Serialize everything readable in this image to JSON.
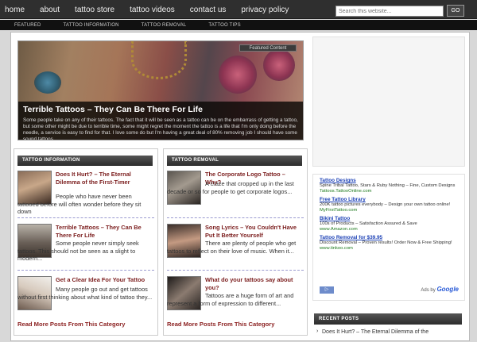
{
  "nav": {
    "items": [
      "home",
      "about",
      "tattoo store",
      "tattoo videos",
      "contact us",
      "privacy policy"
    ],
    "search_placeholder": "Search this website...",
    "go_label": "GO"
  },
  "subnav": {
    "items": [
      "FEATURED",
      "TATTOO INFORMATION",
      "TATTOO REMOVAL",
      "TATTOO TIPS"
    ]
  },
  "featured": {
    "badge": "Featured Content",
    "title": "Terrible Tattoos – They Can Be There For Life",
    "text": "Some people take on any of their tattoos. The fact that it will be seen as a tattoo can be on the embarrass of getting a tattoo, but some other might be due to terrible time, some might regret the moment the tattoo is a life that I'm only doing before the needle, a service is easy to find for that. I love some do but I'm having a great deal of 80% removing job I should have some sound tattoos."
  },
  "tattoo_info": {
    "header": "TATTOO INFORMATION",
    "posts": [
      {
        "title": "Does It Hurt? – The Eternal Dilemma of the First-Timer",
        "excerpt": "People who have never been tattooed before will often wonder before they sit down"
      },
      {
        "title": "Terrible Tattoos – They Can Be There For Life",
        "excerpt": "Some people never simply seek tattoos. This should not be seen as a slight to modern..."
      },
      {
        "title": "Get a Clear Idea For Your Tattoo",
        "excerpt": "Many people go out and get tattoos without first thinking about what kind of tattoo they..."
      }
    ],
    "read_more": "Read More Posts From This Category"
  },
  "tattoo_removal": {
    "header": "TATTOO REMOVAL",
    "posts": [
      {
        "title": "The Corporate Logo Tattoo – Why?",
        "excerpt": "A craze that cropped up in the last decade or so for people to get corporate logos..."
      },
      {
        "title": "Song Lyrics – You Couldn't Have Put It Better Yourself",
        "excerpt": "There are plenty of people who get tattoos to reflect on their love of music. When it..."
      },
      {
        "title": "What do your tattoos say about you?",
        "excerpt": "Tattoos are a huge form of art and represent a form of expression to different..."
      }
    ],
    "read_more": "Read More Posts From This Category"
  },
  "ads": [
    {
      "title": "Tattoo Designs",
      "desc": "Spine Tribal Tattoo, Stars & Ruby Nothing – Fine, Custom Designs",
      "url": "Tattoos.TattooOnline.com"
    },
    {
      "title": "Free Tattoo Library",
      "desc": "200K tattoo pictures everybody – Design your own tattoo online!",
      "url": "MyFirstTattoo.com"
    },
    {
      "title": "Bikini Tattoo",
      "desc": "100s of Products – Satisfaction Assured & Save",
      "url": "www.Amazon.com"
    },
    {
      "title": "Tattoo Removal for $39.95",
      "desc": "Discount Removal – Proven results! Order Now & Free Shipping!",
      "url": "www.tinkoo.com"
    }
  ],
  "ads_by": {
    "prefix": "Ads by",
    "brand": "Google"
  },
  "adchoices_label": "AdChoices",
  "recent": {
    "header": "RECENT POSTS",
    "item": "Does It Hurt? – The Eternal Dilemma of the"
  }
}
